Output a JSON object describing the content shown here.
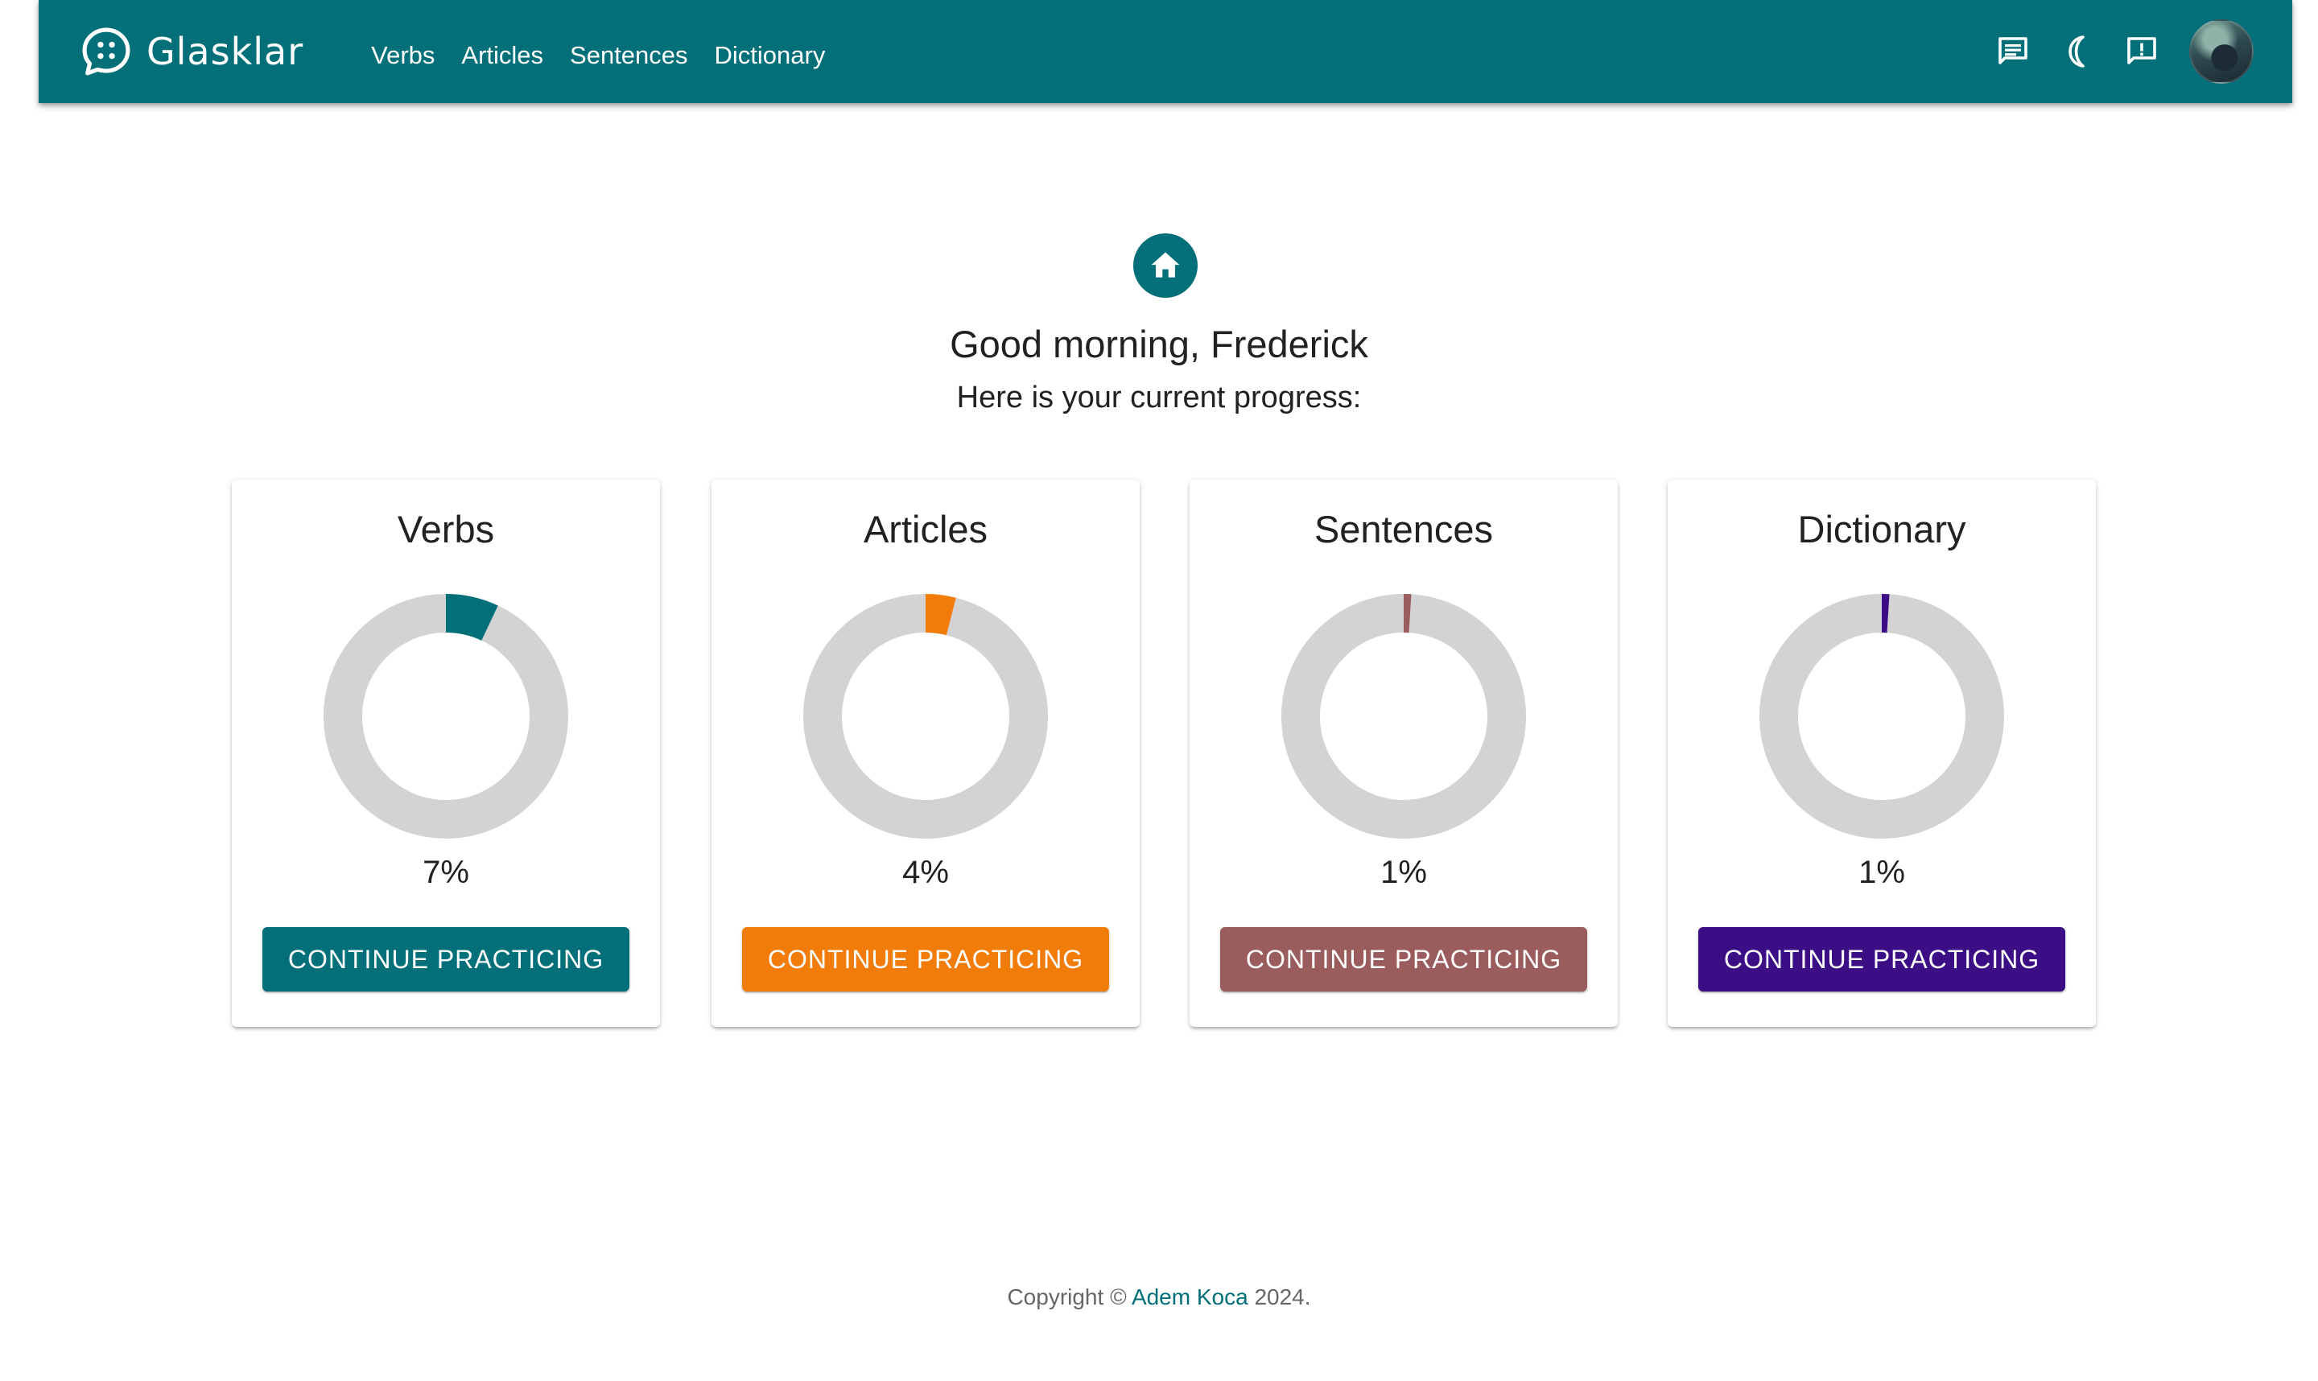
{
  "app": {
    "name": "Glasklar",
    "nav": [
      "Verbs",
      "Articles",
      "Sentences",
      "Dictionary"
    ]
  },
  "header_icons": [
    "chat-icon",
    "dark-mode-moon-icon",
    "feedback-icon",
    "user-avatar"
  ],
  "hero": {
    "icon": "home-icon",
    "greeting": "Good morning, Frederick",
    "subtitle": "Here is your current progress:"
  },
  "cards": [
    {
      "title": "Verbs",
      "progress": 7,
      "percent_label": "7%",
      "button": "CONTINUE PRACTICING",
      "color": "#036f78"
    },
    {
      "title": "Articles",
      "progress": 4,
      "percent_label": "4%",
      "button": "CONTINUE PRACTICING",
      "color": "#f27c0a"
    },
    {
      "title": "Sentences",
      "progress": 1,
      "percent_label": "1%",
      "button": "CONTINUE PRACTICING",
      "color": "#9b5c5e"
    },
    {
      "title": "Dictionary",
      "progress": 1,
      "percent_label": "1%",
      "button": "CONTINUE PRACTICING",
      "color": "#3b0e86"
    }
  ],
  "ring_track_color": "#d3d3d3",
  "footer": {
    "prefix": "Copyright ©",
    "author": "Adem Koca",
    "suffix": "2024."
  }
}
